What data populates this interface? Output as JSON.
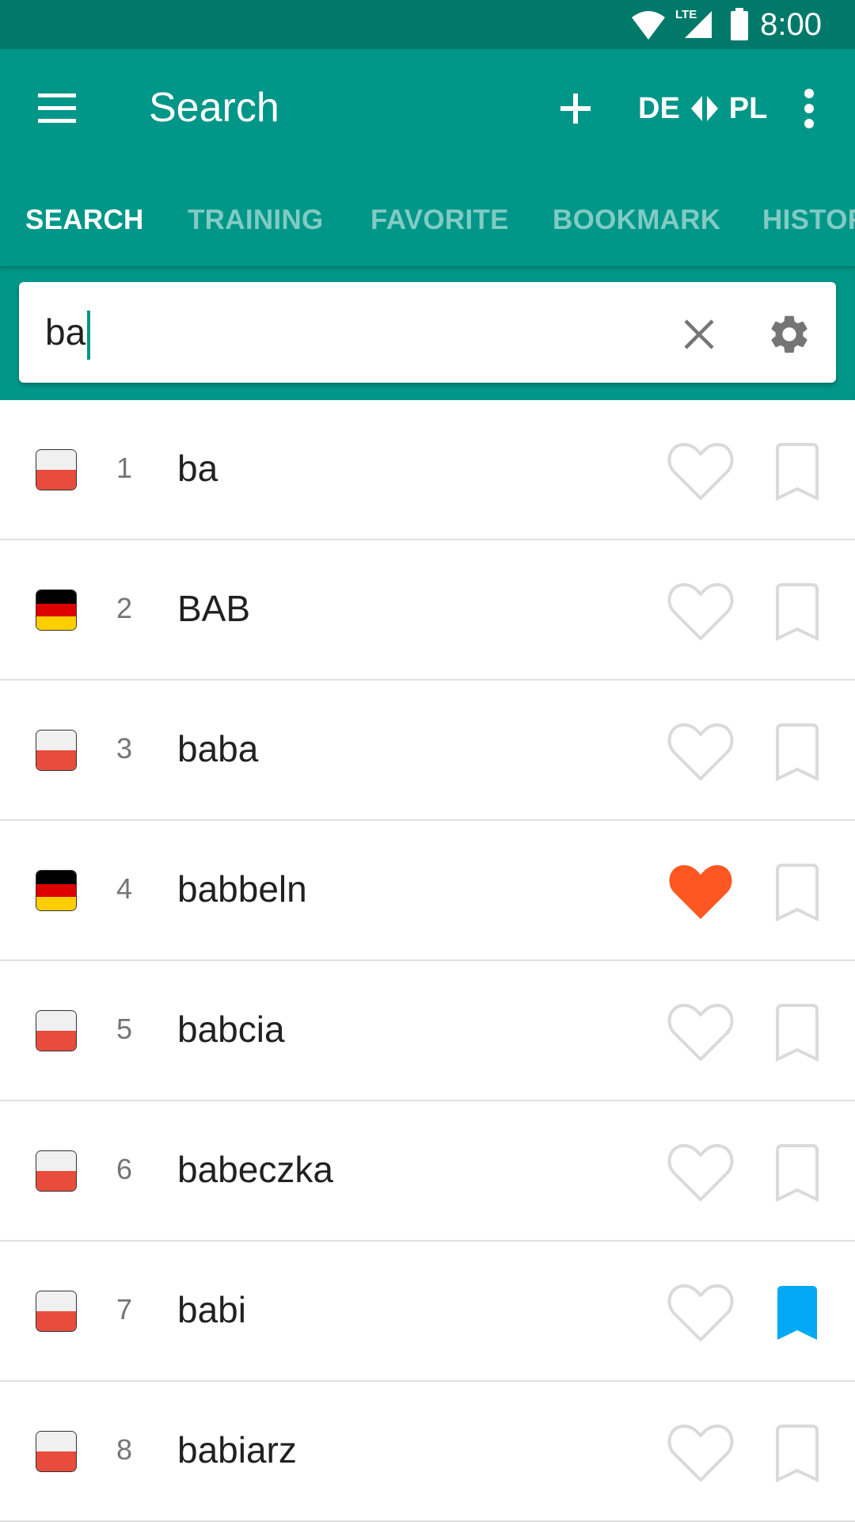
{
  "status_bar": {
    "time": "8:00",
    "network_label": "LTE",
    "icons": [
      "wifi-icon",
      "lte-signal-icon",
      "battery-icon"
    ]
  },
  "app_bar": {
    "title": "Search",
    "add_icon": "plus-icon",
    "language_pair": {
      "from": "DE",
      "to": "PL",
      "swap_icon": "swap-arrows-icon"
    },
    "menu_icon": "hamburger-icon",
    "overflow_icon": "more-vert-icon"
  },
  "tabs": [
    {
      "label": "SEARCH",
      "active": true
    },
    {
      "label": "TRAINING",
      "active": false
    },
    {
      "label": "FAVORITE",
      "active": false
    },
    {
      "label": "BOOKMARK",
      "active": false
    },
    {
      "label": "HISTORY",
      "active": false
    }
  ],
  "search": {
    "value": "ba",
    "clear_icon": "close-icon",
    "settings_icon": "gear-icon"
  },
  "colors": {
    "primary": "#009688",
    "primary_dark": "#00796B",
    "favorite_active": "#FF5722",
    "bookmark_active": "#03A9F4",
    "icon_inactive": "#DADADA"
  },
  "results": [
    {
      "index": "1",
      "word": "ba",
      "lang": "PL",
      "favorite": false,
      "bookmarked": false
    },
    {
      "index": "2",
      "word": "BAB",
      "lang": "DE",
      "favorite": false,
      "bookmarked": false
    },
    {
      "index": "3",
      "word": "baba",
      "lang": "PL",
      "favorite": false,
      "bookmarked": false
    },
    {
      "index": "4",
      "word": "babbeln",
      "lang": "DE",
      "favorite": true,
      "bookmarked": false
    },
    {
      "index": "5",
      "word": "babcia",
      "lang": "PL",
      "favorite": false,
      "bookmarked": false
    },
    {
      "index": "6",
      "word": "babeczka",
      "lang": "PL",
      "favorite": false,
      "bookmarked": false
    },
    {
      "index": "7",
      "word": "babi",
      "lang": "PL",
      "favorite": false,
      "bookmarked": true
    },
    {
      "index": "8",
      "word": "babiarz",
      "lang": "PL",
      "favorite": false,
      "bookmarked": false
    }
  ]
}
